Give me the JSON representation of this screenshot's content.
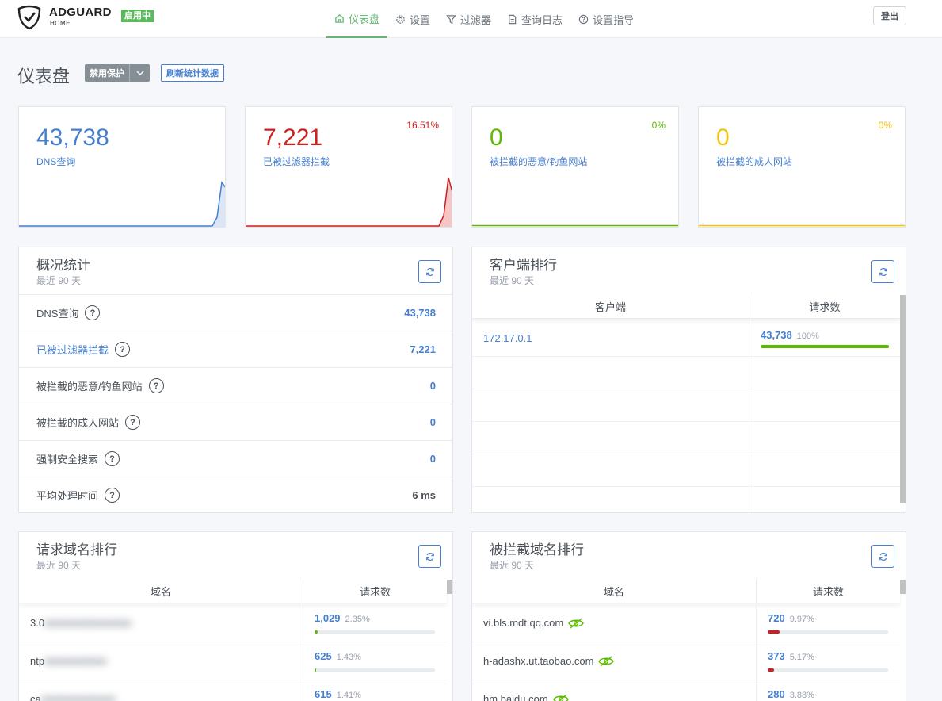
{
  "header": {
    "brand": "ADGUARD",
    "brand_sub": "HOME",
    "status": "启用中",
    "nav": [
      {
        "label": "仪表盘",
        "icon": "home-icon"
      },
      {
        "label": "设置",
        "icon": "gear-icon"
      },
      {
        "label": "过滤器",
        "icon": "filter-icon"
      },
      {
        "label": "查询日志",
        "icon": "log-icon"
      },
      {
        "label": "设置指导",
        "icon": "help-circle-icon"
      }
    ],
    "logout": "登出"
  },
  "page": {
    "title": "仪表盘",
    "disable_protection": "禁用保护",
    "refresh_stats": "刷新统计数据"
  },
  "stats": [
    {
      "value": "43,738",
      "label": "DNS查询",
      "percent": "",
      "color": "#467fcf"
    },
    {
      "value": "7,221",
      "label": "已被过滤器拦截",
      "percent": "16.51%",
      "color": "#cd201f"
    },
    {
      "value": "0",
      "label": "被拦截的恶意/钓鱼网站",
      "percent": "0%",
      "color": "#5eba00"
    },
    {
      "value": "0",
      "label": "被拦截的成人网站",
      "percent": "0%",
      "color": "#f1c40f"
    }
  ],
  "summary": {
    "title": "概况统计",
    "subtitle": "最近 90 天",
    "rows": [
      {
        "label": "DNS查询",
        "value": "43,738"
      },
      {
        "label": "已被过滤器拦截",
        "value": "7,221"
      },
      {
        "label": "被拦截的恶意/钓鱼网站",
        "value": "0"
      },
      {
        "label": "被拦截的成人网站",
        "value": "0"
      },
      {
        "label": "强制安全搜索",
        "value": "0"
      },
      {
        "label": "平均处理时间",
        "value": "6 ms"
      }
    ]
  },
  "clients": {
    "title": "客户端排行",
    "subtitle": "最近 90 天",
    "col1": "客户端",
    "col2": "请求数",
    "rows": [
      {
        "name": "172.17.0.1",
        "count": "43,738",
        "percent": "100%",
        "fill": 1.0
      }
    ]
  },
  "top_domains": {
    "title": "请求域名排行",
    "subtitle": "最近 90 天",
    "col1": "域名",
    "col2": "请求数",
    "rows": [
      {
        "name": "3.0",
        "count": "1,029",
        "percent": "2.35%",
        "fill": 0.0235
      },
      {
        "name": "ntp",
        "count": "625",
        "percent": "1.43%",
        "fill": 0.0143
      },
      {
        "name": "ca",
        "count": "615",
        "percent": "1.41%",
        "fill": 0.0141
      }
    ]
  },
  "blocked_domains": {
    "title": "被拦截域名排行",
    "subtitle": "最近 90 天",
    "col1": "域名",
    "col2": "请求数",
    "rows": [
      {
        "name": "vi.bls.mdt.qq.com",
        "count": "720",
        "percent": "9.97%",
        "fill": 0.0997
      },
      {
        "name": "h-adashx.ut.taobao.com",
        "count": "373",
        "percent": "5.17%",
        "fill": 0.0517
      },
      {
        "name": "hm.baidu.com",
        "count": "280",
        "percent": "3.88%",
        "fill": 0.0388
      }
    ]
  }
}
